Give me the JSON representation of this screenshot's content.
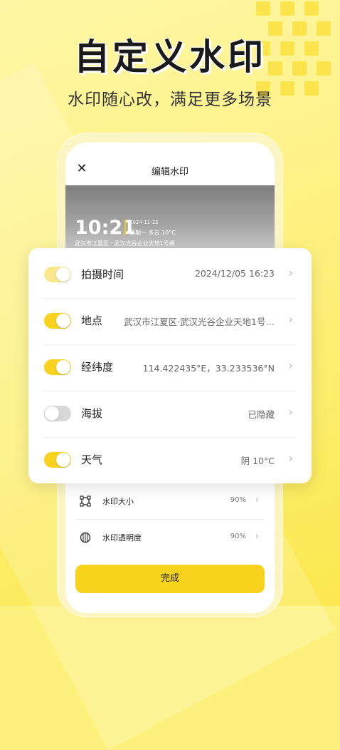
{
  "hero": {
    "title": "自定义水印",
    "subtitle": "水印随心改，满足更多场景"
  },
  "screen": {
    "close_icon": "close-icon",
    "title": "编辑水印",
    "watermark": {
      "time": "10:21",
      "date": "2024-11-25",
      "weather": "星期一  多云 10°C",
      "address": "武汉市江夏区 · 武汉光谷企业天地1号楼"
    },
    "rows": [
      {
        "label": "水印大小",
        "value": "90%",
        "icon": "resize-icon"
      },
      {
        "label": "水印透明度",
        "value": "90%",
        "icon": "opacity-icon"
      }
    ],
    "done_label": "完成"
  },
  "card": {
    "rows": [
      {
        "label": "拍摄时间",
        "value": "2024/12/05  16:23",
        "toggle": "on-light"
      },
      {
        "label": "地点",
        "value": "武汉市江夏区·武汉光谷企业天地1号…",
        "toggle": "on"
      },
      {
        "label": "经纬度",
        "value": "114.422435°E，33.233536°N",
        "toggle": "on"
      },
      {
        "label": "海拔",
        "value": "已隐藏",
        "toggle": "off"
      },
      {
        "label": "天气",
        "value": "阴 10°C",
        "toggle": "on"
      }
    ]
  },
  "colors": {
    "accent": "#f8d21c",
    "background": "#fdf17d"
  }
}
